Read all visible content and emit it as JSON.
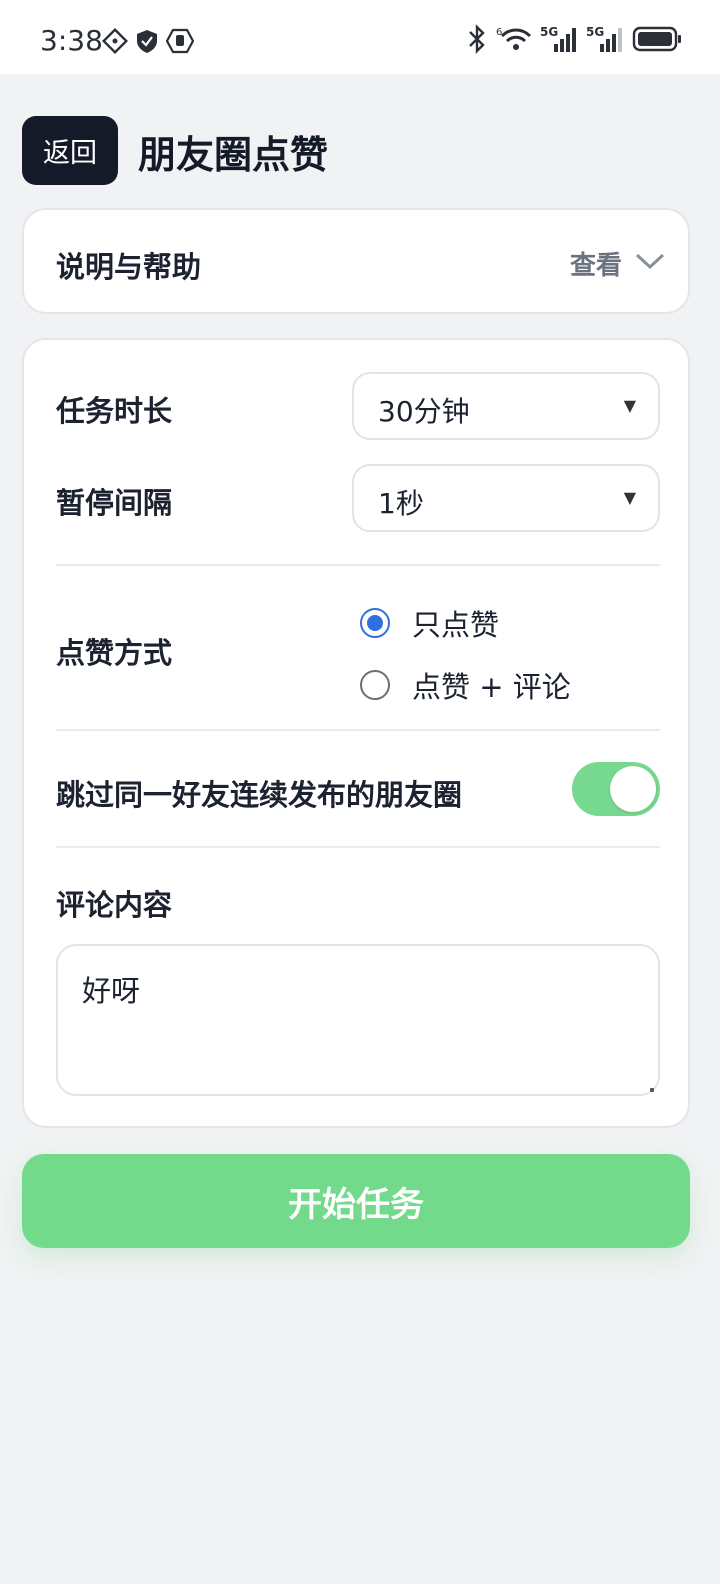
{
  "status_bar": {
    "time": "3:38",
    "left_icons": [
      "diamond-app-icon",
      "shield-icon",
      "hand-icon"
    ],
    "right_icons": [
      "bluetooth-icon",
      "wifi-icon",
      "signal-5g-icon",
      "signal-5g-icon",
      "battery-icon"
    ],
    "net_labels": [
      "6",
      "5G",
      "5G"
    ]
  },
  "header": {
    "back_label": "返回",
    "title": "朋友圈点赞"
  },
  "help": {
    "label": "说明与帮助",
    "view_label": "查看"
  },
  "settings": {
    "duration": {
      "label": "任务时长",
      "value": "30分钟"
    },
    "interval": {
      "label": "暂停间隔",
      "value": "1秒"
    },
    "like_mode": {
      "label": "点赞方式",
      "options": [
        "只点赞",
        "点赞 + 评论"
      ],
      "selected_index": 0
    },
    "skip_consecutive": {
      "label": "跳过同一好友连续发布的朋友圈",
      "enabled": true
    },
    "comment": {
      "label": "评论内容",
      "value": "好呀"
    }
  },
  "start_button": {
    "label": "开始任务"
  },
  "colors": {
    "accent_green": "#73d98b",
    "radio_blue": "#2f6fe0",
    "back_button": "#141a28"
  }
}
